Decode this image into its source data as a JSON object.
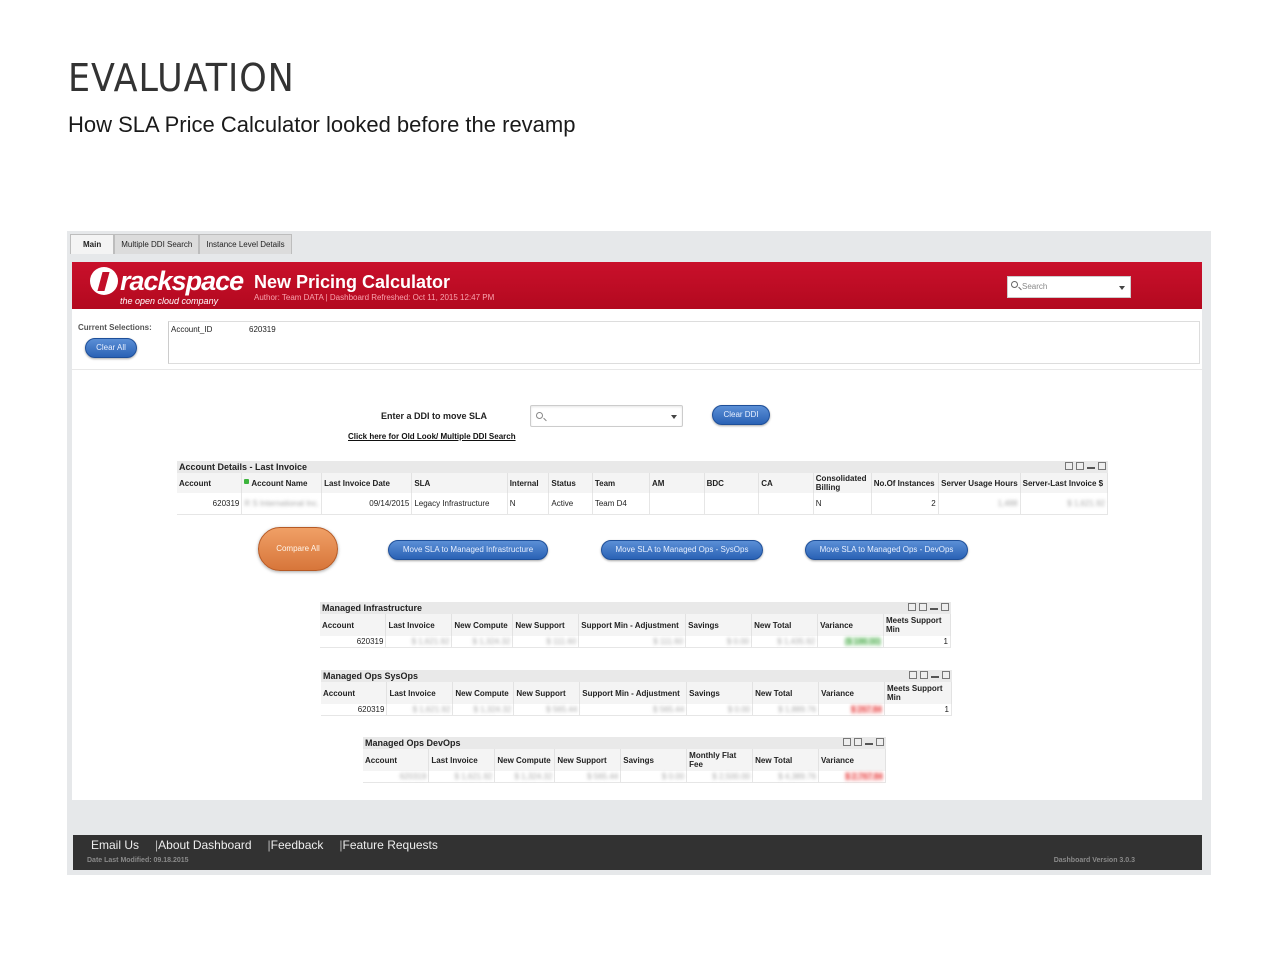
{
  "page": {
    "heading": "EVALUATION",
    "subheading": "How SLA Price Calculator looked before the revamp"
  },
  "tabs": [
    {
      "label": "Main",
      "active": true
    },
    {
      "label": "Multiple DDI Search",
      "active": false
    },
    {
      "label": "Instance Level Details",
      "active": false
    }
  ],
  "header": {
    "logo_word": "rackspace",
    "logo_tagline": "the open cloud company",
    "title": "New Pricing Calculator",
    "author_line": "Author: Team DATA | Dashboard Refreshed: Oct 11, 2015  12:47 PM",
    "search_placeholder": "Search",
    "brand_color": "#c20f29"
  },
  "selections": {
    "label": "Current Selections:",
    "clear_all": "Clear All",
    "field": "Account_ID",
    "value": "620319"
  },
  "ddi": {
    "label": "Enter a DDI to move SLA",
    "clear_button": "Clear DDI",
    "old_look_link": "Click here for Old Look/ Multiple DDI Search"
  },
  "account_details": {
    "title": "Account Details - Last Invoice",
    "columns": [
      "Account",
      "Account Name",
      "Last Invoice Date",
      "SLA",
      "Internal",
      "Status",
      "Team",
      "AM",
      "BDC",
      "CA",
      "Consolidated Billing",
      "No.Of Instances",
      "Server Usage Hours",
      "Server-Last Invoice $"
    ],
    "row": {
      "account": "620319",
      "account_name": "R S International Inc.",
      "last_invoice_date": "09/14/2015",
      "sla": "Legacy Infrastructure",
      "internal": "N",
      "status": "Active",
      "team": "Team D4",
      "am": "",
      "bdc": "",
      "ca": "",
      "consolidated_billing": "N",
      "instances": "2",
      "server_usage_hours": "1,488",
      "server_last_invoice": "$ 1,621.92"
    }
  },
  "actions": {
    "compare_all": "Compare All",
    "move_infra": "Move SLA to Managed Infrastructure",
    "move_sysops": "Move SLA to Managed Ops - SysOps",
    "move_devops": "Move SLA to Managed Ops - DevOps"
  },
  "managed_infra": {
    "title": "Managed Infrastructure",
    "columns": [
      "Account",
      "Last Invoice",
      "New Compute",
      "New Support",
      "Support Min - Adjustment",
      "Savings",
      "New Total",
      "Variance",
      "Meets Support Min"
    ],
    "row": [
      "620319",
      "$ 1,621.92",
      "$ 1,324.32",
      "$ 111.60",
      "$ 111.60",
      "$ 0.00",
      "$ 1,435.92",
      "($ 186.00)",
      "1"
    ]
  },
  "managed_sysops": {
    "title": "Managed Ops SysOps",
    "columns": [
      "Account",
      "Last Invoice",
      "New Compute",
      "New Support",
      "Support Min - Adjustment",
      "Savings",
      "New Total",
      "Variance",
      "Meets Support Min"
    ],
    "row": [
      "620319",
      "$ 1,621.92",
      "$ 1,324.32",
      "$ 565.44",
      "$ 565.44",
      "$ 0.00",
      "$ 1,889.76",
      "$ 267.84",
      "1"
    ]
  },
  "managed_devops": {
    "title": "Managed Ops DevOps",
    "columns": [
      "Account",
      "Last Invoice",
      "New Compute",
      "New Support",
      "Savings",
      "Monthly Flat Fee",
      "New Total",
      "Variance"
    ],
    "row": [
      "620319",
      "$ 1,621.92",
      "$ 1,324.32",
      "$ 565.44",
      "$ 0.00",
      "$ 2,500.00",
      "$ 4,389.76",
      "$ 2,767.84"
    ]
  },
  "footer": {
    "links": [
      "Email Us",
      "About Dashboard",
      "Feedback",
      "Feature Requests"
    ],
    "date_modified": "Date Last Modified: 09.18.2015",
    "version": "Dashboard Version 3.0.3"
  }
}
